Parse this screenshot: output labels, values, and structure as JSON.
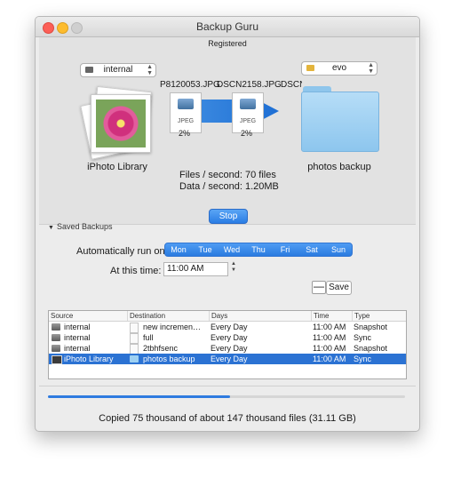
{
  "window": {
    "title": "Backup Guru"
  },
  "top": {
    "registered": "Registered",
    "source_drive": "internal",
    "dest_drive": "evo",
    "source_label": "iPhoto Library",
    "dest_label": "photos backup",
    "files": [
      {
        "name": "P8120053.JPG",
        "type": "JPEG",
        "percent": "2%"
      },
      {
        "name": "DSCN2158.JPG",
        "type": "JPEG",
        "percent": "2%"
      },
      {
        "name": "DSCN"
      }
    ],
    "files_per_second": "Files / second: 70 files",
    "data_per_second": "Data / second: 1.20MB",
    "stop_label": "Stop"
  },
  "saved": {
    "header": "Saved Backups",
    "auto_run_label": "Automatically run on:",
    "days": [
      "Mon",
      "Tue",
      "Wed",
      "Thu",
      "Fri",
      "Sat",
      "Sun"
    ],
    "time_label": "At this time:",
    "time_value": "11:00 AM",
    "minus_label": "—",
    "save_label": "Save"
  },
  "table": {
    "headers": [
      "Source",
      "Destination",
      "Days",
      "Time",
      "Type"
    ],
    "rows": [
      {
        "source": "internal",
        "destination": "new incremen…",
        "days": "Every Day",
        "time": "11:00 AM",
        "type": "Snapshot",
        "selected": false
      },
      {
        "source": "internal",
        "destination": "full",
        "days": "Every Day",
        "time": "11:00 AM",
        "type": "Sync",
        "selected": false
      },
      {
        "source": "internal",
        "destination": "2tbhfsenc",
        "days": "Every Day",
        "time": "11:00 AM",
        "type": "Snapshot",
        "selected": false
      },
      {
        "source": "iPhoto Library",
        "destination": "photos backup",
        "days": "Every Day",
        "time": "11:00 AM",
        "type": "Sync",
        "selected": true
      }
    ]
  },
  "progress": {
    "fraction": 0.51
  },
  "status": "Copied 75 thousand of about 147 thousand files (31.11 GB)",
  "colors": {
    "accent": "#2b72d3",
    "folder": "#8dc6ee"
  }
}
